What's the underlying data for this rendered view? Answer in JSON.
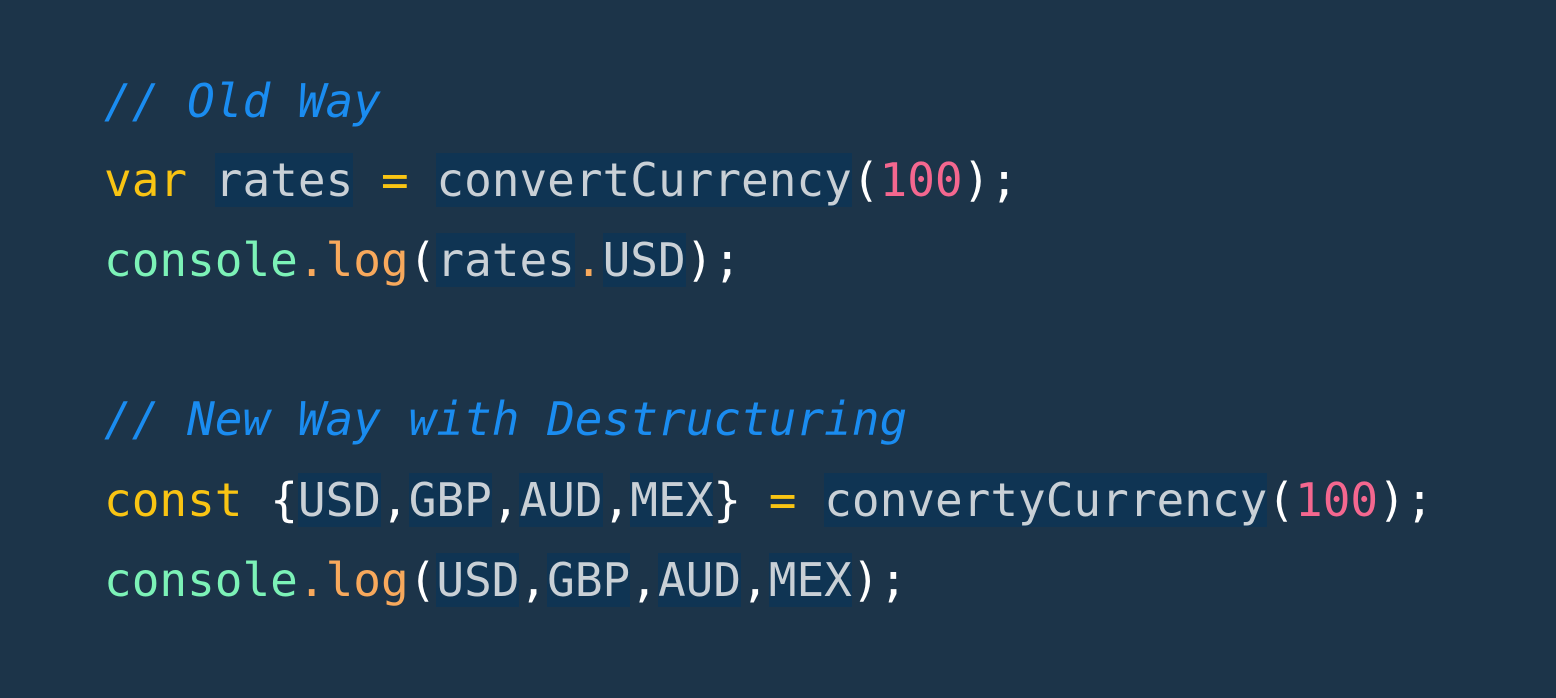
{
  "code": {
    "comment_old": "// Old Way",
    "l1_kw": "var",
    "l1_var": "rates",
    "l1_op": "=",
    "l1_fn": "convertCurrency",
    "l1_open": "(",
    "l1_num": "100",
    "l1_close": ");",
    "l2_obj": "console",
    "l2_dot": ".",
    "l2_method": "log",
    "l2_open": "(",
    "l2_rates": "rates",
    "l2_dot2": ".",
    "l2_usd": "USD",
    "l2_close": ");",
    "comment_new": "// New Way with Destructuring",
    "l3_kw": "const",
    "l3_brace_open": "{",
    "l3_usd": "USD",
    "l3_c1": ",",
    "l3_gbp": "GBP",
    "l3_c2": ",",
    "l3_aud": "AUD",
    "l3_c3": ",",
    "l3_mex": "MEX",
    "l3_brace_close": "}",
    "l3_op": "=",
    "l3_fn": "convertyCurrency",
    "l3_open": "(",
    "l3_num": "100",
    "l3_close": ");",
    "l4_obj": "console",
    "l4_dot": ".",
    "l4_method": "log",
    "l4_open": "(",
    "l4_usd": "USD",
    "l4_c1": ",",
    "l4_gbp": "GBP",
    "l4_c2": ",",
    "l4_aud": "AUD",
    "l4_c3": ",",
    "l4_mex": "MEX",
    "l4_close": ");"
  },
  "colors": {
    "background": "#1c3449",
    "comment": "#1a8cf0",
    "keyword": "#f9c413",
    "object": "#7cf2b7",
    "method": "#f8a95c",
    "number": "#f4678f",
    "identifier": "#c9d0d6",
    "identifier_highlight": "#0f3453"
  }
}
